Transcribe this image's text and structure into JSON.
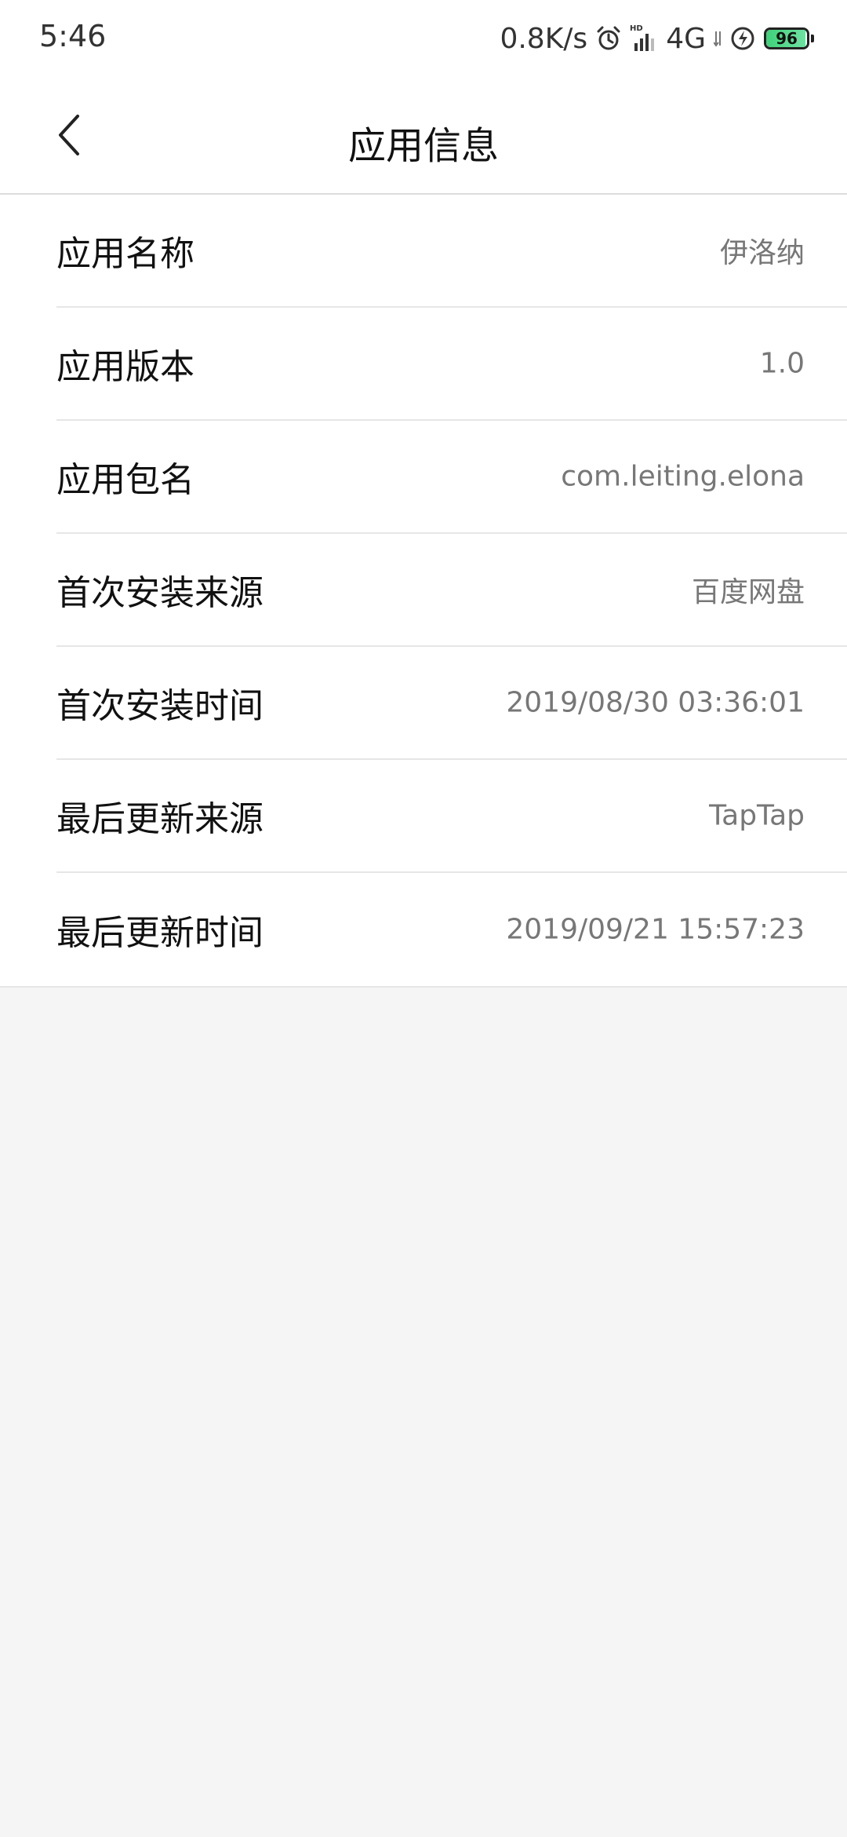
{
  "status_bar": {
    "time": "5:46",
    "net_speed": "0.8K/s",
    "network": "4G",
    "battery": "96",
    "battery_fraction": 0.96
  },
  "header": {
    "title": "应用信息",
    "back_icon": "chevron-left-icon"
  },
  "rows": [
    {
      "label": "应用名称",
      "value": "伊洛纳"
    },
    {
      "label": "应用版本",
      "value": "1.0"
    },
    {
      "label": "应用包名",
      "value": "com.leiting.elona"
    },
    {
      "label": "首次安装来源",
      "value": "百度网盘"
    },
    {
      "label": "首次安装时间",
      "value": "2019/08/30 03:36:01"
    },
    {
      "label": "最后更新来源",
      "value": "TapTap"
    },
    {
      "label": "最后更新时间",
      "value": "2019/09/21 15:57:23"
    }
  ]
}
